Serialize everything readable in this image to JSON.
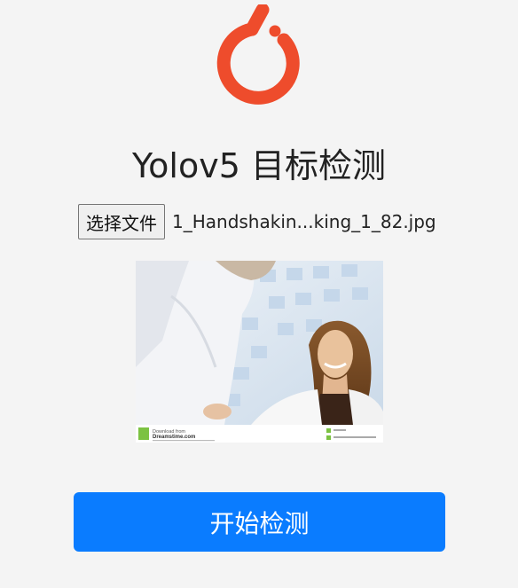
{
  "header": {
    "title": "Yolov5 目标检测"
  },
  "file_input": {
    "button_label": "选择文件",
    "file_name": "1_Handshakin...king_1_82.jpg"
  },
  "preview": {
    "watermark_line1": "Download from",
    "watermark_line2": "Dreamstime.com"
  },
  "actions": {
    "detect_label": "开始检测"
  },
  "colors": {
    "background": "#f4f4f4",
    "logo": "#ee4c2c",
    "primary_button": "#0a7cff"
  },
  "icons": {
    "logo": "pytorch-logo-icon"
  }
}
